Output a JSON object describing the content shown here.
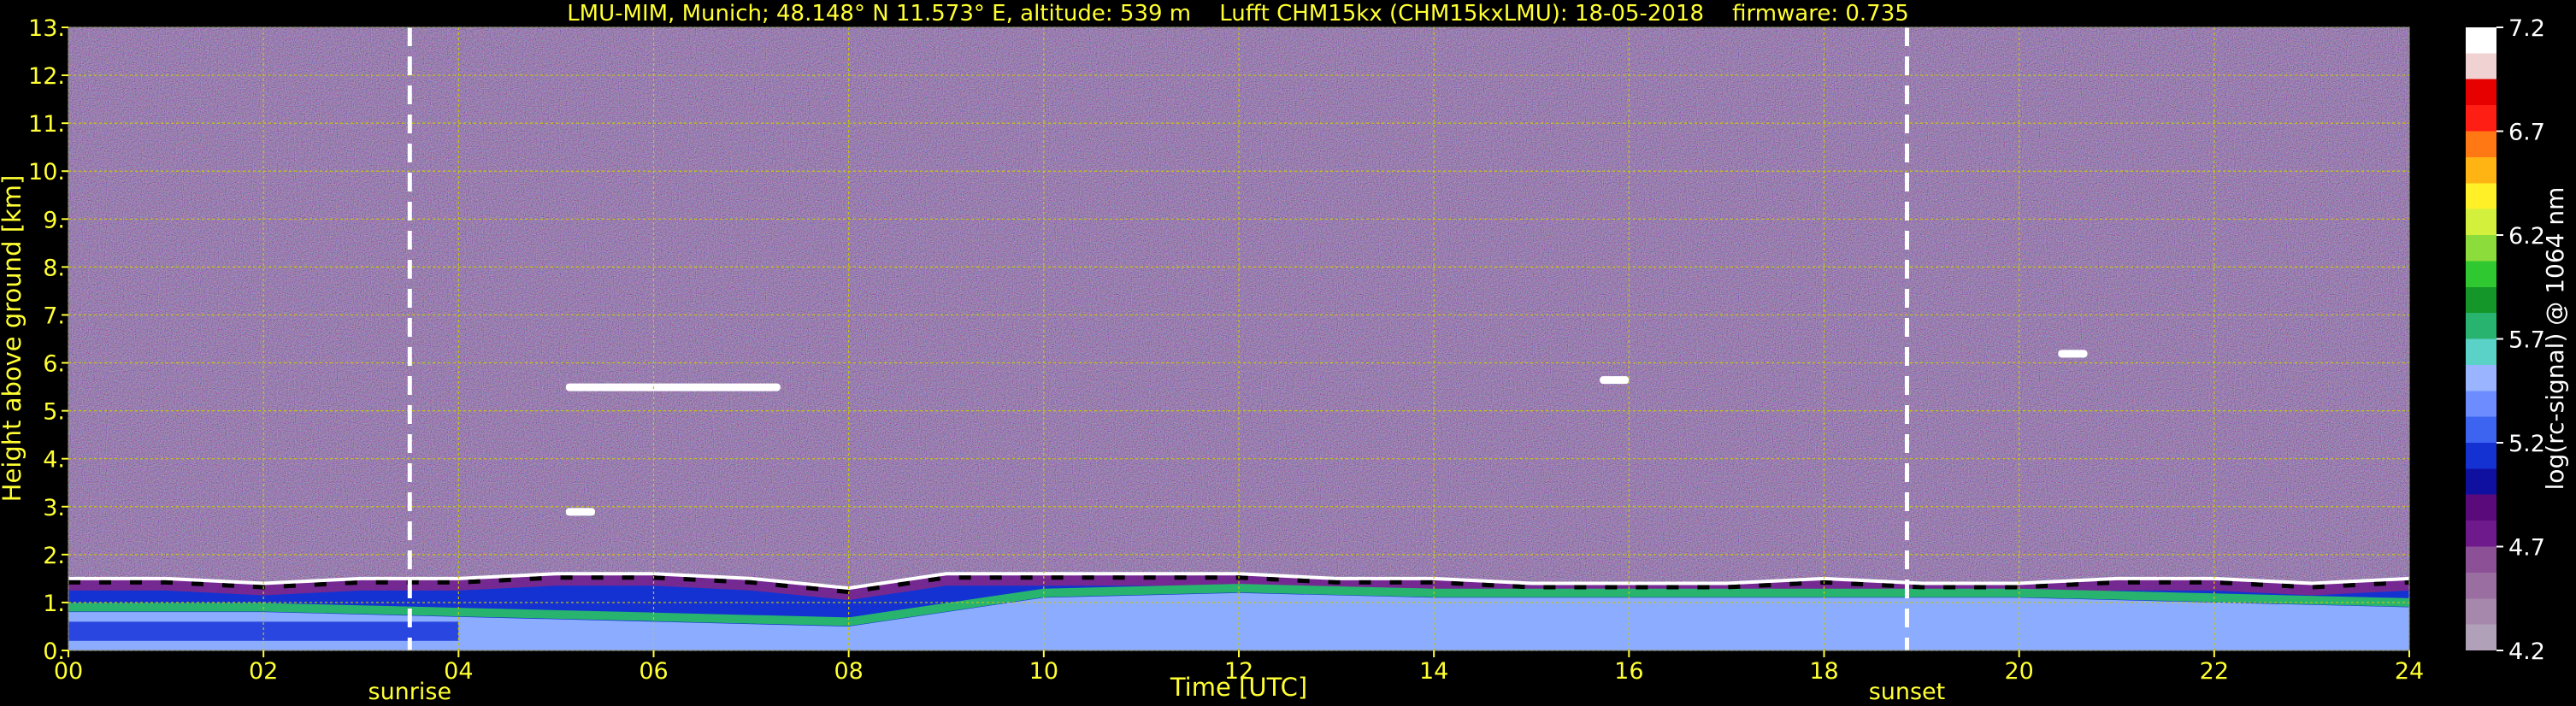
{
  "chart_data": {
    "type": "heatmap",
    "title": "LMU-MIM, Munich; 48.148° N 11.573° E, altitude: 539 m    Lufft CHM15kx (CHM15kxLMU): 18-05-2018    firmware: 0.735",
    "xlabel": "Time [UTC]",
    "ylabel": "Height above ground [km]",
    "xlim": [
      0,
      24
    ],
    "ylim": [
      0,
      13
    ],
    "x_ticks": [
      "00",
      "02",
      "04",
      "06",
      "08",
      "10",
      "12",
      "14",
      "16",
      "18",
      "20",
      "22",
      "24"
    ],
    "x_tick_values": [
      0,
      2,
      4,
      6,
      8,
      10,
      12,
      14,
      16,
      18,
      20,
      22,
      24
    ],
    "y_ticks": [
      "0.",
      "1.",
      "2.",
      "3.",
      "4.",
      "5.",
      "6.",
      "7.",
      "8.",
      "9.",
      "10.",
      "11.",
      "12.",
      "13."
    ],
    "y_tick_values": [
      0,
      1,
      2,
      3,
      4,
      5,
      6,
      7,
      8,
      9,
      10,
      11,
      12,
      13
    ],
    "grid": true,
    "annotations": [
      {
        "label": "sunrise",
        "x": 3.5
      },
      {
        "label": "sunset",
        "x": 18.85
      }
    ],
    "colorbar": {
      "label": "log(rc-signal) @ 1064 nm",
      "range": [
        4.2,
        7.2
      ],
      "ticks": [
        "4.2",
        "4.7",
        "5.2",
        "5.7",
        "6.2",
        "6.7",
        "7.2"
      ],
      "tick_values": [
        4.2,
        4.7,
        5.2,
        5.7,
        6.2,
        6.7,
        7.2
      ],
      "colors": [
        "#b0a0b8",
        "#a688ac",
        "#9a6ea0",
        "#8c5096",
        "#6e1a8c",
        "#5a0a7a",
        "#1010a0",
        "#1432d2",
        "#3c64f0",
        "#6c8cff",
        "#9ab4ff",
        "#5ad2c8",
        "#28b46e",
        "#149628",
        "#30c830",
        "#8cdc3c",
        "#d2f03c",
        "#fff028",
        "#ffb414",
        "#ff7814",
        "#ff1e14",
        "#e60000",
        "#f0d2d2",
        "#ffffff"
      ]
    },
    "layers": [
      {
        "kind": "boundary-layer-cloud-top",
        "x": [
          0,
          1,
          2,
          3,
          4,
          5,
          6,
          7,
          8,
          9,
          10,
          11,
          12,
          13,
          14,
          15,
          16,
          17,
          18,
          19,
          20,
          21,
          22,
          23,
          24
        ],
        "y": [
          1.5,
          1.5,
          1.4,
          1.5,
          1.5,
          1.6,
          1.6,
          1.5,
          1.3,
          1.6,
          1.6,
          1.6,
          1.6,
          1.5,
          1.5,
          1.4,
          1.4,
          1.4,
          1.5,
          1.4,
          1.4,
          1.5,
          1.5,
          1.4,
          1.5
        ]
      },
      {
        "kind": "aerosol-layer-top",
        "x": [
          0,
          2,
          4,
          6,
          8,
          10,
          12,
          14,
          16,
          18,
          20,
          22,
          24
        ],
        "y": [
          0.9,
          0.9,
          0.8,
          0.7,
          0.6,
          1.2,
          1.3,
          1.2,
          1.2,
          1.2,
          1.2,
          1.1,
          1.0
        ]
      },
      {
        "kind": "elevated-cloud",
        "x": [
          5.1,
          7.3
        ],
        "y": 5.5
      },
      {
        "kind": "elevated-cloud",
        "x": [
          5.1,
          5.4
        ],
        "y": 2.9
      },
      {
        "kind": "elevated-cloud",
        "x": [
          15.7,
          16.0
        ],
        "y": 5.65
      },
      {
        "kind": "elevated-cloud",
        "x": [
          20.4,
          20.7
        ],
        "y": 6.2
      }
    ]
  }
}
